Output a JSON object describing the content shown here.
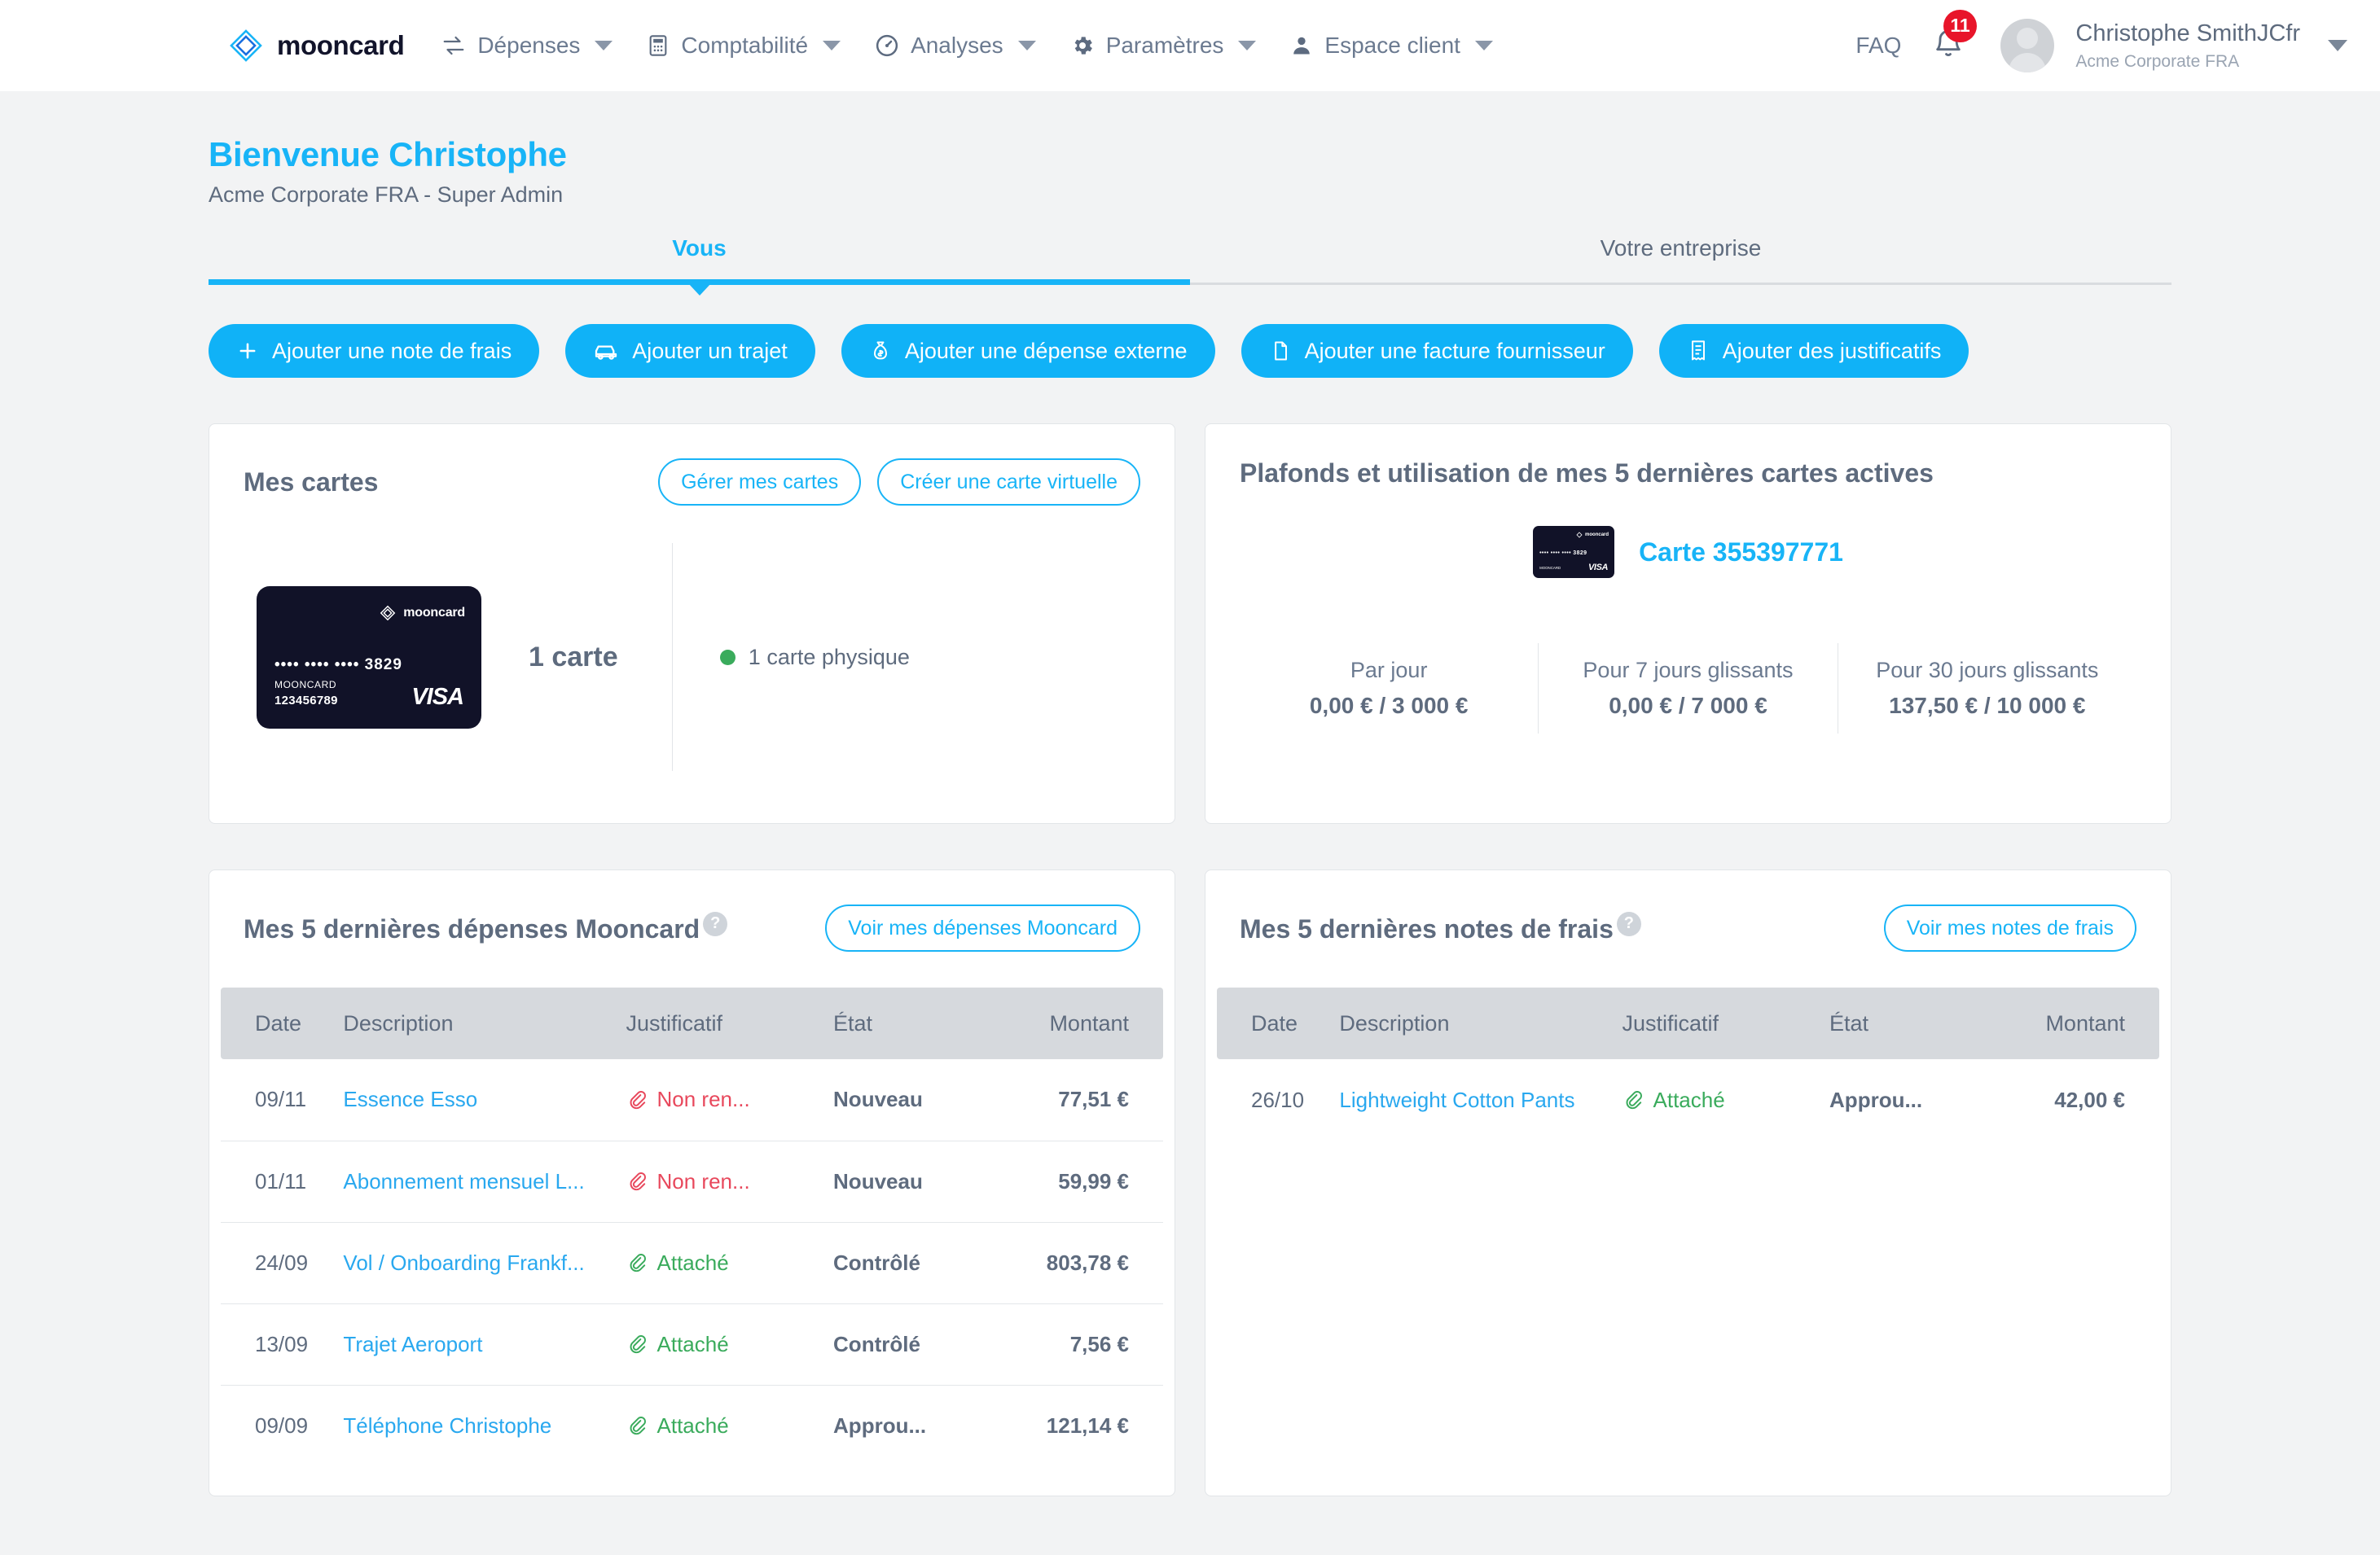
{
  "nav": {
    "brand": "mooncard",
    "items": [
      {
        "label": "Dépenses",
        "icon": "transfer-icon",
        "caret": true
      },
      {
        "label": "Comptabilité",
        "icon": "calculator-icon",
        "caret": true
      },
      {
        "label": "Analyses",
        "icon": "gauge-icon",
        "caret": true
      },
      {
        "label": "Paramètres",
        "icon": "gear-icon",
        "caret": true
      },
      {
        "label": "Espace client",
        "icon": "person-icon",
        "caret": true
      }
    ],
    "faq": "FAQ",
    "notification_count": "11",
    "user_name": "Christophe SmithJCfr",
    "user_org": "Acme Corporate FRA"
  },
  "welcome": {
    "title": "Bienvenue Christophe",
    "subtitle": "Acme Corporate FRA - Super Admin"
  },
  "tabs": [
    {
      "label": "Vous",
      "active": true
    },
    {
      "label": "Votre entreprise",
      "active": false
    }
  ],
  "actions": [
    {
      "label": "Ajouter une note de frais",
      "icon": "plus-icon"
    },
    {
      "label": "Ajouter un trajet",
      "icon": "car-icon"
    },
    {
      "label": "Ajouter une dépense externe",
      "icon": "money-bag-icon"
    },
    {
      "label": "Ajouter une facture fournisseur",
      "icon": "document-icon"
    },
    {
      "label": "Ajouter des justificatifs",
      "icon": "receipt-icon"
    }
  ],
  "my_cards": {
    "title": "Mes cartes",
    "manage_button": "Gérer mes cartes",
    "create_button": "Créer une carte virtuelle",
    "card": {
      "brand": "mooncard",
      "number": "•••• •••• •••• 3829",
      "holder_label": "MOONCARD",
      "holder_id": "123456789",
      "network": "VISA"
    },
    "count": "1 carte",
    "physical": "1 carte physique",
    "physical_dot_color": "#3aab5c"
  },
  "limits": {
    "title": "Plafonds et utilisation de mes 5 dernières cartes actives",
    "card_name": "Carte 355397771",
    "columns": [
      {
        "label": "Par jour",
        "value": "0,00 € / 3 000 €"
      },
      {
        "label": "Pour 7 jours glissants",
        "value": "0,00 € / 7 000 €"
      },
      {
        "label": "Pour 30 jours glissants",
        "value": "137,50 € / 10 000 €"
      }
    ]
  },
  "expenses": {
    "title": "Mes 5 dernières dépenses Mooncard",
    "help": "?",
    "view_button": "Voir mes dépenses Mooncard",
    "columns": [
      "Date",
      "Description",
      "Justificatif",
      "État",
      "Montant"
    ],
    "rows": [
      {
        "date": "09/11",
        "description": "Essence Esso",
        "justificatif": "Non ren...",
        "justificatif_state": "missing",
        "etat": "Nouveau",
        "montant": "77,51 €"
      },
      {
        "date": "01/11",
        "description": "Abonnement mensuel L...",
        "justificatif": "Non ren...",
        "justificatif_state": "missing",
        "etat": "Nouveau",
        "montant": "59,99 €"
      },
      {
        "date": "24/09",
        "description": "Vol / Onboarding Frankf...",
        "justificatif": "Attaché",
        "justificatif_state": "attached",
        "etat": "Contrôlé",
        "montant": "803,78 €"
      },
      {
        "date": "13/09",
        "description": "Trajet Aeroport",
        "justificatif": "Attaché",
        "justificatif_state": "attached",
        "etat": "Contrôlé",
        "montant": "7,56 €"
      },
      {
        "date": "09/09",
        "description": "Téléphone Christophe",
        "justificatif": "Attaché",
        "justificatif_state": "attached",
        "etat": "Approu...",
        "montant": "121,14 €"
      }
    ]
  },
  "notes": {
    "title": "Mes 5 dernières notes de frais",
    "help": "?",
    "view_button": "Voir mes notes de frais",
    "columns": [
      "Date",
      "Description",
      "Justificatif",
      "État",
      "Montant"
    ],
    "rows": [
      {
        "date": "26/10",
        "description": "Lightweight Cotton Pants",
        "justificatif": "Attaché",
        "justificatif_state": "attached",
        "etat": "Approu...",
        "montant": "42,00 €"
      }
    ]
  },
  "colors": {
    "accent": "#18b4f7",
    "text": "#5e6b7e",
    "danger": "#e8485c",
    "success": "#3aab5c",
    "badge": "#e8152a"
  }
}
